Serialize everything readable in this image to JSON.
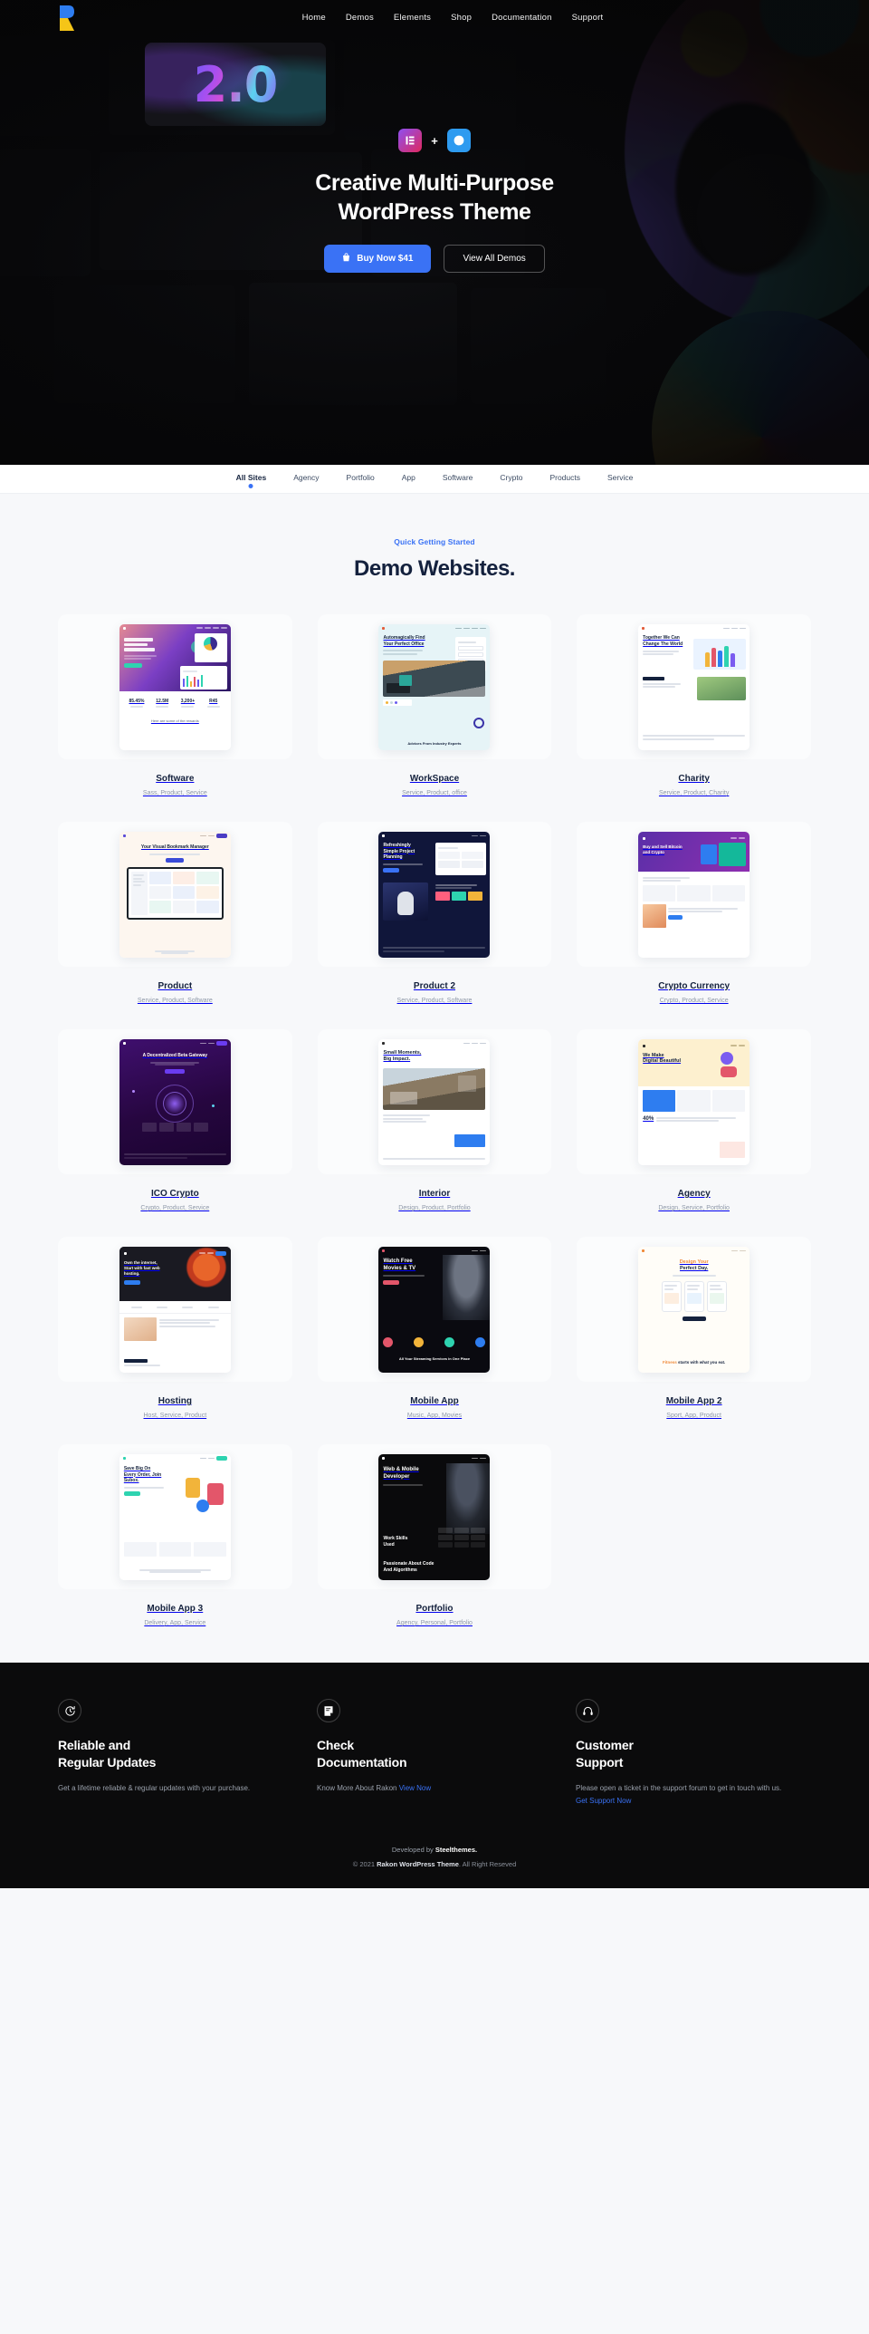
{
  "nav": {
    "logo_icon": "rakon-logo-icon",
    "links": [
      {
        "label": "Home"
      },
      {
        "label": "Demos"
      },
      {
        "label": "Elements"
      },
      {
        "label": "Shop"
      },
      {
        "label": "Documentation"
      },
      {
        "label": "Support"
      }
    ]
  },
  "hero": {
    "version_art": "2.0",
    "elementor_badge": "elementor-icon",
    "plus": "+",
    "wordpress_badge": "wordpress-icon",
    "title_line1": "Creative Multi-Purpose",
    "title_line2": "WordPress Theme",
    "buy_label": "Buy Now $41",
    "demos_label": "View All Demos",
    "accent": "#3a72f5"
  },
  "filters": [
    {
      "label": "All Sites",
      "active": true
    },
    {
      "label": "Agency",
      "active": false
    },
    {
      "label": "Portfolio",
      "active": false
    },
    {
      "label": "App",
      "active": false
    },
    {
      "label": "Software",
      "active": false
    },
    {
      "label": "Crypto",
      "active": false
    },
    {
      "label": "Products",
      "active": false
    },
    {
      "label": "Service",
      "active": false
    }
  ],
  "demos": {
    "eyebrow": "Quick Getting Started",
    "title": "Demo Websites.",
    "items": [
      {
        "title": "Software",
        "tags": "Sass, Product, Service"
      },
      {
        "title": "WorkSpace",
        "tags": "Service, Product, office"
      },
      {
        "title": "Charity",
        "tags": "Service, Product, Charity"
      },
      {
        "title": "Product",
        "tags": "Service, Product, Software"
      },
      {
        "title": "Product 2",
        "tags": "Service, Product, Software"
      },
      {
        "title": "Crypto Currency",
        "tags": "Crypto, Product, Service"
      },
      {
        "title": "ICO Crypto",
        "tags": "Crypto, Product, Service"
      },
      {
        "title": "Interior",
        "tags": "Design, Product, Portfolio"
      },
      {
        "title": "Agency",
        "tags": "Design, Service, Portfolio"
      },
      {
        "title": "Hosting",
        "tags": "Host, Service, Product"
      },
      {
        "title": "Mobile App",
        "tags": "Music, App, Movies"
      },
      {
        "title": "Mobile App 2",
        "tags": "Sport, App, Product"
      },
      {
        "title": "Mobile App 3",
        "tags": "Delivery, App, Service"
      },
      {
        "title": "Portfolio",
        "tags": "Agency, Personal, Portfolio"
      }
    ],
    "thumb_text": {
      "software_heading": "In Technology People Make Great Difference",
      "software_stats": [
        "85.45%",
        "12.5M",
        "3,200+",
        "R45"
      ],
      "software_footer": "Here are some of the rewards",
      "workspace_heading_1": "Automagically Find",
      "workspace_heading_2": "Your Perfect Office",
      "workspace_footer": "Advices From Industry Experts",
      "charity_heading": "Together We Can Change The World",
      "product_heading": "Your Visual Bookmark Manager",
      "product2_heading": "Refreshingly Simple Project Planning",
      "crypto_heading": "Buy and Sell Bitcoin and Crypto",
      "ico_heading": "A Decentralized Beta Gateway",
      "interior_heading": "Small Moments, Big Impact.",
      "agency_heading_1": "We Make",
      "agency_heading_2": "Digital Beautiful",
      "hosting_heading": "Own the internet, Start with fast web hosting.",
      "mobileapp_heading_1": "Watch Free",
      "mobileapp_heading_2": "Movies & TV",
      "mobileapp_footer": "All Your Streaming Services in One Place",
      "mobileapp2_heading_1": "Design Your",
      "mobileapp2_heading_2": "Perfect Day.",
      "mobileapp2_footer_1": "Fitness",
      "mobileapp2_footer_2": "starts with what you eat.",
      "mobileapp3_heading": "Save Big On Every Order, Join Subox.",
      "portfolio_heading_1": "Web & Mobile",
      "portfolio_heading_2": "Developer",
      "portfolio_sub": "Work Skills Used",
      "portfolio_footer": "Passionate About Code And Algorithms"
    }
  },
  "footer": {
    "columns": [
      {
        "icon": "refresh-clock-icon",
        "title_line1": "Reliable and",
        "title_line2": "Regular Updates",
        "text": "Get a lifetime reliable & regular updates with your purchase.",
        "link": "",
        "text_after": ""
      },
      {
        "icon": "document-icon",
        "title_line1": "Check",
        "title_line2": "Documentation",
        "text": "Know More About Rakon ",
        "link": "View Now",
        "text_after": ""
      },
      {
        "icon": "headset-icon",
        "title_line1": "Customer",
        "title_line2": "Support",
        "text": "Please open a ticket in the support forum to get in touch with us. ",
        "link": "Get Support Now",
        "text_after": ""
      }
    ],
    "developed_prefix": "Developed by ",
    "developed_brand": "Steelthemes.",
    "copy_prefix": "© 2021 ",
    "copy_brand": "Rakon WordPress Theme",
    "copy_suffix": ". All Right Reseved"
  }
}
